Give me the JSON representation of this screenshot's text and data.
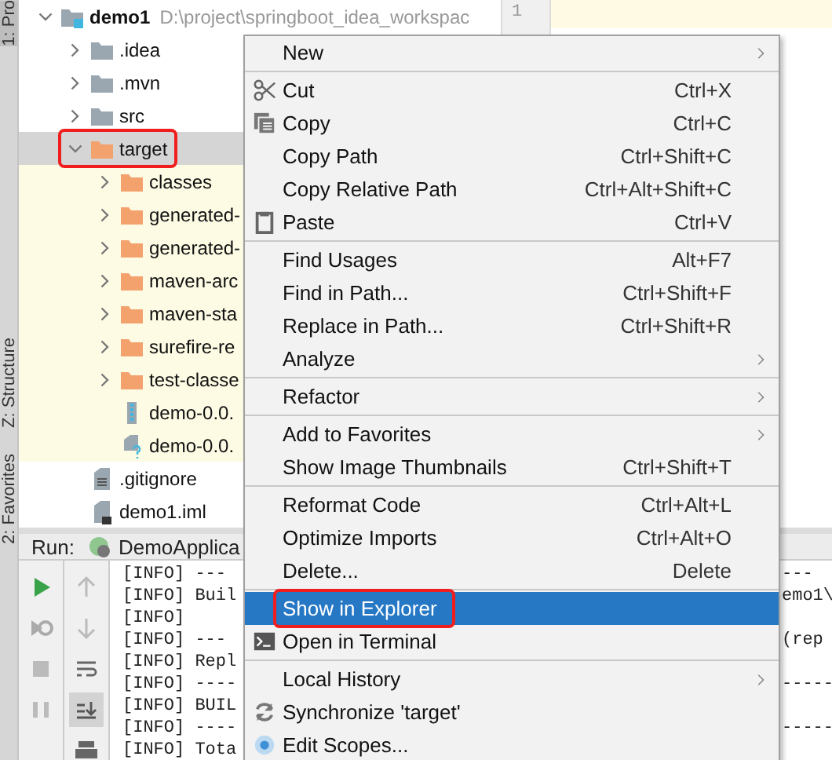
{
  "side_tabs": [
    {
      "label": "1: Pro",
      "selected": true
    },
    {
      "label": "Z: Structure",
      "selected": false
    },
    {
      "label": "2: Favorites",
      "selected": false
    }
  ],
  "project_tree": {
    "name": "demo1",
    "path": "D:\\project\\springboot_idea_workspac",
    "kind": "module",
    "expanded": true,
    "selected": false,
    "annotated": false,
    "excluded": false,
    "children": [
      {
        "name": ".idea",
        "kind": "folder",
        "expanded": false,
        "selected": false,
        "annotated": false,
        "excluded": false
      },
      {
        "name": ".mvn",
        "kind": "folder",
        "expanded": false,
        "selected": false,
        "annotated": false,
        "excluded": false
      },
      {
        "name": "src",
        "kind": "folder",
        "expanded": false,
        "selected": false,
        "annotated": false,
        "excluded": false
      },
      {
        "name": "target",
        "kind": "folder",
        "expanded": true,
        "selected": true,
        "annotated": true,
        "excluded": true,
        "children": [
          {
            "name": "classes",
            "kind": "folder",
            "expanded": false,
            "selected": false,
            "annotated": false,
            "excluded": true
          },
          {
            "name": "generated-",
            "kind": "folder",
            "expanded": false,
            "selected": false,
            "annotated": false,
            "excluded": true
          },
          {
            "name": "generated-",
            "kind": "folder",
            "expanded": false,
            "selected": false,
            "annotated": false,
            "excluded": true
          },
          {
            "name": "maven-arc",
            "kind": "folder",
            "expanded": false,
            "selected": false,
            "annotated": false,
            "excluded": true
          },
          {
            "name": "maven-sta",
            "kind": "folder",
            "expanded": false,
            "selected": false,
            "annotated": false,
            "excluded": true
          },
          {
            "name": "surefire-re",
            "kind": "folder",
            "expanded": false,
            "selected": false,
            "annotated": false,
            "excluded": true
          },
          {
            "name": "test-classe",
            "kind": "folder",
            "expanded": false,
            "selected": false,
            "annotated": false,
            "excluded": true
          },
          {
            "name": "demo-0.0.",
            "kind": "jar",
            "selected": false,
            "annotated": false,
            "excluded": true
          },
          {
            "name": "demo-0.0.",
            "kind": "unknown-file",
            "selected": false,
            "annotated": false,
            "excluded": true
          }
        ]
      },
      {
        "name": ".gitignore",
        "kind": "text-file",
        "selected": false,
        "annotated": false,
        "excluded": false
      },
      {
        "name": "demo1.iml",
        "kind": "module-file",
        "selected": false,
        "annotated": false,
        "excluded": false
      }
    ]
  },
  "editor": {
    "line_numbers": [
      "1"
    ]
  },
  "run_panel": {
    "label": "Run:",
    "tab": "DemoApplica",
    "toolbar": [
      {
        "kind": "run",
        "selected": false
      },
      {
        "kind": "rerun",
        "selected": false
      },
      {
        "kind": "stop",
        "selected": false
      },
      {
        "kind": "pause",
        "selected": false
      }
    ],
    "toolbar_2": [
      {
        "kind": "up",
        "selected": false
      },
      {
        "kind": "down",
        "selected": false
      },
      {
        "kind": "wrap",
        "selected": false
      },
      {
        "kind": "scroll-end",
        "selected": true
      },
      {
        "kind": "print",
        "selected": false
      }
    ],
    "console": [
      {
        "text": "[INFO] ---",
        "right_text": "---"
      },
      {
        "text": "[INFO] Buil",
        "right_text": "emo1\\"
      },
      {
        "text": "[INFO]"
      },
      {
        "text": "[INFO] ---",
        "right_text": "(rep"
      },
      {
        "text": "[INFO] Repl"
      },
      {
        "text": "[INFO] ----",
        "right_text": "-----"
      },
      {
        "text": "[INFO] BUIL"
      },
      {
        "text": "[INFO] ----",
        "right_text": "-----"
      },
      {
        "text": "[INFO] Tota"
      }
    ]
  },
  "context_menu": [
    {
      "kind": "item",
      "label": "New",
      "submenu": true,
      "selected": false,
      "annotated": false
    },
    {
      "kind": "separator"
    },
    {
      "kind": "item",
      "label": "Cut",
      "shortcut": "Ctrl+X",
      "submenu": false,
      "selected": false,
      "annotated": false
    },
    {
      "kind": "item",
      "label": "Copy",
      "shortcut": "Ctrl+C",
      "submenu": false,
      "selected": false,
      "annotated": false
    },
    {
      "kind": "item",
      "label": "Copy Path",
      "shortcut": "Ctrl+Shift+C",
      "submenu": false,
      "selected": false,
      "annotated": false
    },
    {
      "kind": "item",
      "label": "Copy Relative Path",
      "shortcut": "Ctrl+Alt+Shift+C",
      "submenu": false,
      "selected": false,
      "annotated": false
    },
    {
      "kind": "item",
      "label": "Paste",
      "shortcut": "Ctrl+V",
      "submenu": false,
      "selected": false,
      "annotated": false
    },
    {
      "kind": "separator"
    },
    {
      "kind": "item",
      "label": "Find Usages",
      "shortcut": "Alt+F7",
      "submenu": false,
      "selected": false,
      "annotated": false
    },
    {
      "kind": "item",
      "label": "Find in Path...",
      "shortcut": "Ctrl+Shift+F",
      "submenu": false,
      "selected": false,
      "annotated": false
    },
    {
      "kind": "item",
      "label": "Replace in Path...",
      "shortcut": "Ctrl+Shift+R",
      "submenu": false,
      "selected": false,
      "annotated": false
    },
    {
      "kind": "item",
      "label": "Analyze",
      "submenu": true,
      "selected": false,
      "annotated": false
    },
    {
      "kind": "separator"
    },
    {
      "kind": "item",
      "label": "Refactor",
      "submenu": true,
      "selected": false,
      "annotated": false
    },
    {
      "kind": "separator"
    },
    {
      "kind": "item",
      "label": "Add to Favorites",
      "submenu": true,
      "selected": false,
      "annotated": false
    },
    {
      "kind": "item",
      "label": "Show Image Thumbnails",
      "shortcut": "Ctrl+Shift+T",
      "submenu": false,
      "selected": false,
      "annotated": false
    },
    {
      "kind": "separator"
    },
    {
      "kind": "item",
      "label": "Reformat Code",
      "shortcut": "Ctrl+Alt+L",
      "submenu": false,
      "selected": false,
      "annotated": false
    },
    {
      "kind": "item",
      "label": "Optimize Imports",
      "shortcut": "Ctrl+Alt+O",
      "submenu": false,
      "selected": false,
      "annotated": false
    },
    {
      "kind": "item",
      "label": "Delete...",
      "shortcut": "Delete",
      "submenu": false,
      "selected": false,
      "annotated": false
    },
    {
      "kind": "separator"
    },
    {
      "kind": "item",
      "label": "Show in Explorer",
      "submenu": false,
      "selected": true,
      "annotated": true
    },
    {
      "kind": "item",
      "label": "Open in Terminal",
      "submenu": false,
      "selected": false,
      "annotated": false
    },
    {
      "kind": "separator"
    },
    {
      "kind": "item",
      "label": "Local History",
      "submenu": true,
      "selected": false,
      "annotated": false
    },
    {
      "kind": "item",
      "label": "Synchronize 'target'",
      "submenu": false,
      "selected": false,
      "annotated": false
    },
    {
      "kind": "item",
      "label": "Edit Scopes...",
      "submenu": false,
      "selected": false,
      "annotated": false
    }
  ]
}
